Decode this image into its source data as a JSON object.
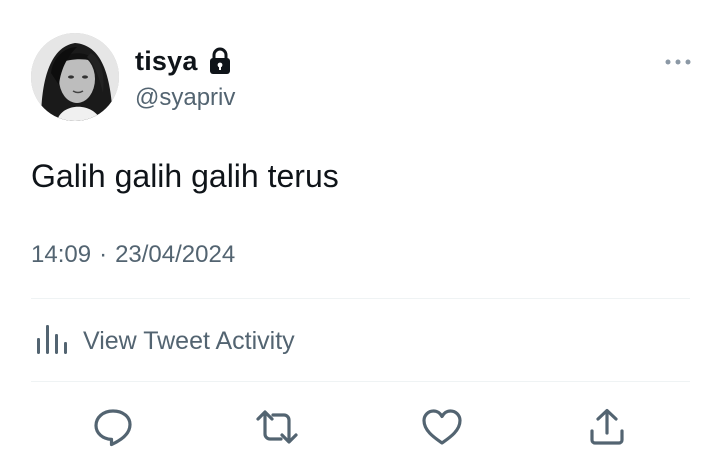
{
  "tweet": {
    "author": {
      "display_name": "tisya",
      "handle": "@syapriv",
      "protected": true
    },
    "text": "Galih galih galih terus",
    "time": "14:09",
    "separator": "·",
    "date": "23/04/2024"
  },
  "activity": {
    "label": "View Tweet Activity"
  },
  "icons": {
    "lock": "lock-icon",
    "more": "more-icon",
    "analytics": "bar-chart-icon",
    "reply": "reply-icon",
    "retweet": "retweet-icon",
    "like": "heart-icon",
    "share": "share-icon"
  },
  "colors": {
    "primary_text": "#0f1419",
    "secondary_text": "#536471",
    "divider": "#eff3f4"
  }
}
